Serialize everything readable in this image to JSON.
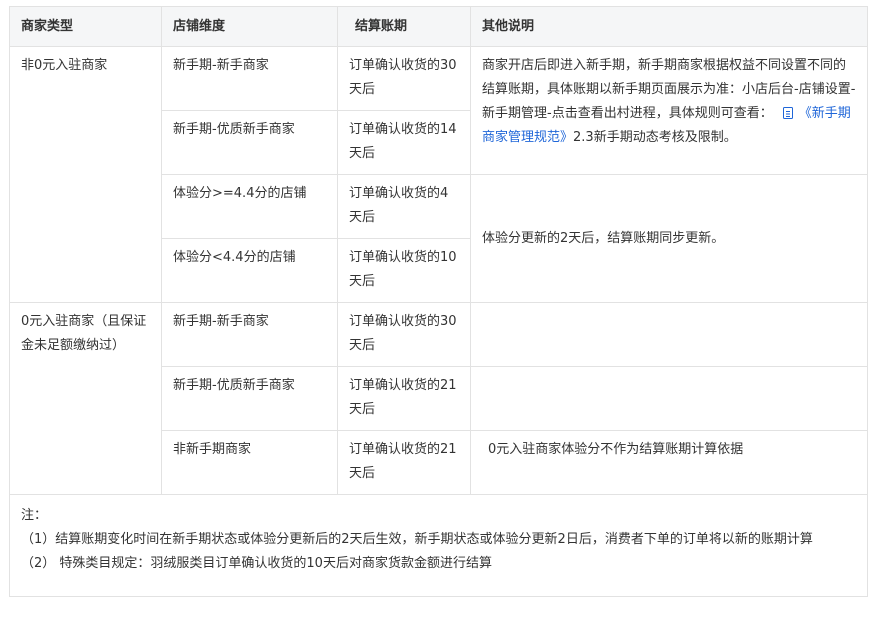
{
  "headers": [
    "商家类型",
    "店铺维度",
    "结算账期",
    "其他说明"
  ],
  "groups": [
    {
      "merchant_type": "非0元入驻商家",
      "rows": [
        {
          "dimension": "新手期-新手商家",
          "period": "订单确认收货的30天后"
        },
        {
          "dimension": "新手期-优质新手商家",
          "period": "订单确认收货的14天后"
        },
        {
          "dimension": "体验分>=4.4分的店铺",
          "period": "订单确认收货的4天后"
        },
        {
          "dimension": "体验分<4.4分的店铺",
          "period": "订单确认收货的10天后"
        }
      ],
      "remark1": {
        "text_before": "商家开店后即进入新手期，新手期商家根据权益不同设置不同的结算账期，具体账期以新手期页面展示为准：小店后台-店铺设置-新手期管理-点击查看出村进程，具体规则可查看：",
        "link_text": "《新手期商家管理规范》",
        "text_after": "2.3新手期动态考核及限制。"
      },
      "remark2": "体验分更新的2天后，结算账期同步更新。"
    },
    {
      "merchant_type": "0元入驻商家（且保证金未足额缴纳过）",
      "rows": [
        {
          "dimension": "新手期-新手商家",
          "period": "订单确认收货的30天后"
        },
        {
          "dimension": "新手期-优质新手商家",
          "period": "订单确认收货的21天后"
        },
        {
          "dimension": "非新手期商家",
          "period": "订单确认收货的21天后"
        }
      ],
      "remark3": "0元入驻商家体验分不作为结算账期计算依据"
    }
  ],
  "notes": {
    "title": "注：",
    "items": [
      "（1）结算账期变化时间在新手期状态或体验分更新后的2天后生效，新手期状态或体验分更新2日后，消费者下单的订单将以新的账期计算",
      "（2） 特殊类目规定：羽绒服类目订单确认收货的10天后对商家货款金额进行结算"
    ]
  }
}
